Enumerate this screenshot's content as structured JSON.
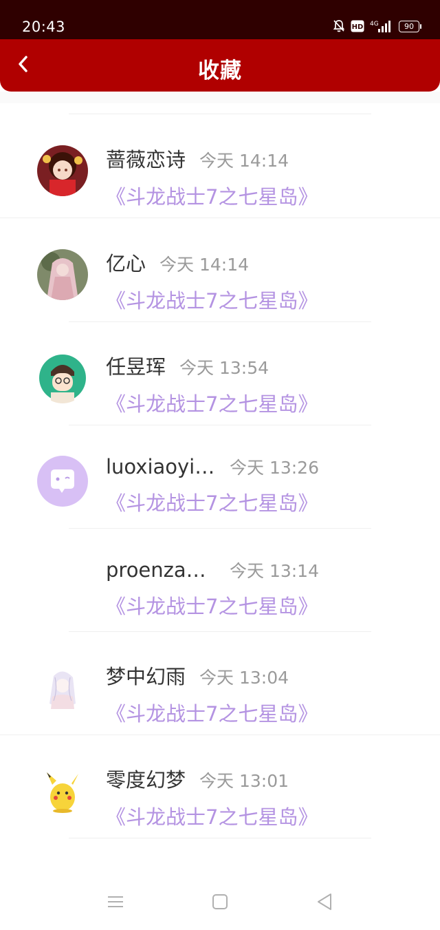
{
  "status_bar": {
    "time": "20:43",
    "icons": [
      "bell-off-icon",
      "hd-icon",
      "signal-4g-icon"
    ],
    "battery": "90"
  },
  "header": {
    "title": "收藏",
    "back_icon": "chevron-left-icon",
    "background": "#b00000"
  },
  "colors": {
    "book_title": "#b493e2",
    "timestamp": "#9a9a9a",
    "name": "#333333"
  },
  "list": {
    "items": [
      {
        "name": "蔷薇恋诗",
        "time": "今天 14:14",
        "book": "《斗龙战士7之七星岛》",
        "avatar": "anime-girl-red-avatar"
      },
      {
        "name": "亿心",
        "time": "今天 14:14",
        "book": "《斗龙战士7之七星岛》",
        "avatar": "veiled-girl-avatar"
      },
      {
        "name": "任昱珲",
        "time": "今天 13:54",
        "book": "《斗龙战士7之七星岛》",
        "avatar": "cartoon-boy-avatar"
      },
      {
        "name": "luoxiaoyid...",
        "time": "今天 13:26",
        "book": "《斗龙战士7之七星岛》",
        "avatar": "default-chat-avatar"
      },
      {
        "name": "proenzasc...",
        "time": "今天 13:14",
        "book": "《斗龙战士7之七星岛》",
        "avatar": "blank-avatar"
      },
      {
        "name": "梦中幻雨",
        "time": "今天 13:04",
        "book": "《斗龙战士7之七星岛》",
        "avatar": "sketch-girl-avatar"
      },
      {
        "name": "零度幻梦",
        "time": "今天 13:01",
        "book": "《斗龙战士7之七星岛》",
        "avatar": "pikachu-avatar"
      }
    ]
  },
  "nav_bar": {
    "icons": [
      "menu-icon",
      "home-square-icon",
      "back-triangle-icon"
    ]
  }
}
